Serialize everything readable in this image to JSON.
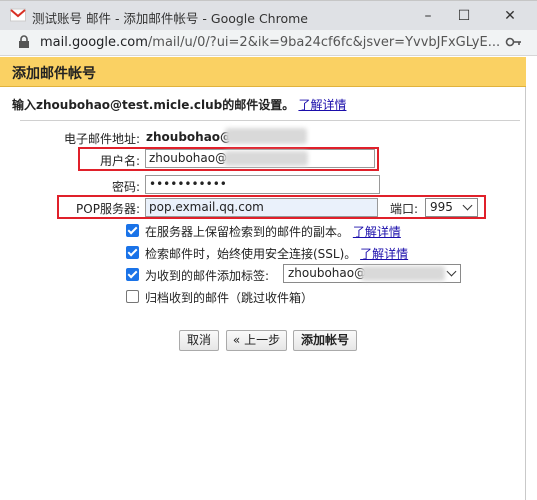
{
  "window": {
    "title": "测试账号 邮件 - 添加邮件帐号 - Google Chrome",
    "minimize": "–",
    "maximize": "☐",
    "close": "✕"
  },
  "address": {
    "host": "mail.google.com",
    "path": "/mail/u/0/?ui=2&ik=9ba24cf6fc&jsver=YvvbJFxGLyE..."
  },
  "dialog": {
    "title": "添加邮件帐号",
    "instructions_prefix": "输入zhoubohao@test.micle.club的邮件设置。",
    "learn_more": "了解详情"
  },
  "form": {
    "email_label": "电子邮件地址:",
    "email_value": "zhoubohao@",
    "username_label": "用户名:",
    "username_value": "zhoubohao@",
    "password_label": "密码:",
    "password_value": "•••••••••••",
    "pop_label": "POP服务器:",
    "pop_value": "pop.exmail.qq.com",
    "port_label": "端口:",
    "port_value": "995"
  },
  "options": {
    "keep_copy": "在服务器上保留检索到的邮件的副本。",
    "keep_copy_link": "了解详情",
    "ssl": "检索邮件时，始终使用安全连接(SSL)。",
    "ssl_link": "了解详情",
    "label": "为收到的邮件添加标签:",
    "label_value": "zhoubohao@",
    "archive": "归档收到的邮件（跳过收件箱）"
  },
  "buttons": {
    "cancel": "取消",
    "back": "« 上一步",
    "add": "添加帐号"
  },
  "colors": {
    "dialog_header": "#fad163",
    "highlight": "#e0202a",
    "checkbox": "#1a73e8"
  }
}
